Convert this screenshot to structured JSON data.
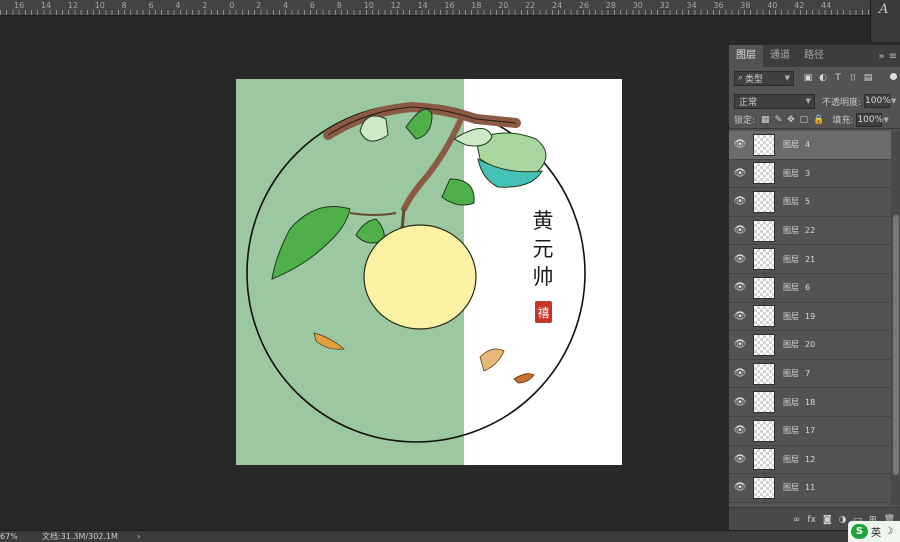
{
  "ruler": {
    "numbers": [
      "16",
      "14",
      "12",
      "10",
      "8",
      "6",
      "4",
      "2",
      "0",
      "2",
      "4",
      "6",
      "8",
      "10",
      "12",
      "14",
      "16",
      "18",
      "20",
      "22",
      "24",
      "26",
      "28",
      "30",
      "32",
      "34",
      "36",
      "38",
      "40",
      "42",
      "44"
    ]
  },
  "right_toolbar": {
    "glyph": "A"
  },
  "canvas": {
    "calligraphy": [
      "黄",
      "元",
      "帅"
    ],
    "seal_text": "禧",
    "colors": {
      "green": "#9bc8a0",
      "white": "#ffffff",
      "apple": "#fbf2a4",
      "leaf": "#4fb04a",
      "leaf_teal": "#45c2b8",
      "branch": "#8a5a44"
    }
  },
  "panel": {
    "tabs": [
      "图层",
      "通道",
      "路径"
    ],
    "tab_tools": [
      "»",
      "≡"
    ],
    "filter": {
      "label": "类型",
      "icons": [
        "▣",
        "◐",
        "T",
        "⌷",
        "▤"
      ]
    },
    "blend_mode": "正常",
    "opacity_label": "不透明度:",
    "opacity_value": "100%",
    "lock_label": "锁定:",
    "lock_icons": [
      "▦",
      "✎",
      "✥",
      "▢",
      "🔒"
    ],
    "fill_label": "填充:",
    "fill_value": "100%",
    "layers": [
      {
        "prefix": "图层",
        "num": "4",
        "visible_icon": "👁",
        "selected": true
      },
      {
        "prefix": "图层",
        "num": "3",
        "visible_icon": "👁",
        "selected": false
      },
      {
        "prefix": "图层",
        "num": "5",
        "visible_icon": "👁",
        "selected": false
      },
      {
        "prefix": "图层",
        "num": "22",
        "visible_icon": "👁",
        "selected": false
      },
      {
        "prefix": "图层",
        "num": "21",
        "visible_icon": "👁",
        "selected": false
      },
      {
        "prefix": "图层",
        "num": "6",
        "visible_icon": "👁",
        "selected": false
      },
      {
        "prefix": "图层",
        "num": "19",
        "visible_icon": "👁",
        "selected": false
      },
      {
        "prefix": "图层",
        "num": "20",
        "visible_icon": "👁",
        "selected": false
      },
      {
        "prefix": "图层",
        "num": "7",
        "visible_icon": "👁",
        "selected": false
      },
      {
        "prefix": "图层",
        "num": "18",
        "visible_icon": "👁",
        "selected": false
      },
      {
        "prefix": "图层",
        "num": "17",
        "visible_icon": "👁",
        "selected": false
      },
      {
        "prefix": "图层",
        "num": "12",
        "visible_icon": "👁",
        "selected": false
      },
      {
        "prefix": "图层",
        "num": "11",
        "visible_icon": "👁",
        "selected": false
      }
    ],
    "footer_icons": [
      "∞",
      "fx",
      "◙",
      "◑",
      "▭",
      "⊞",
      "🗑"
    ]
  },
  "status": {
    "zoom": "67%",
    "doc": "文档:31.3M/302.1M",
    "arrow": "›"
  },
  "ime": {
    "logo": "S",
    "lang": "英",
    "moon": "☽"
  }
}
